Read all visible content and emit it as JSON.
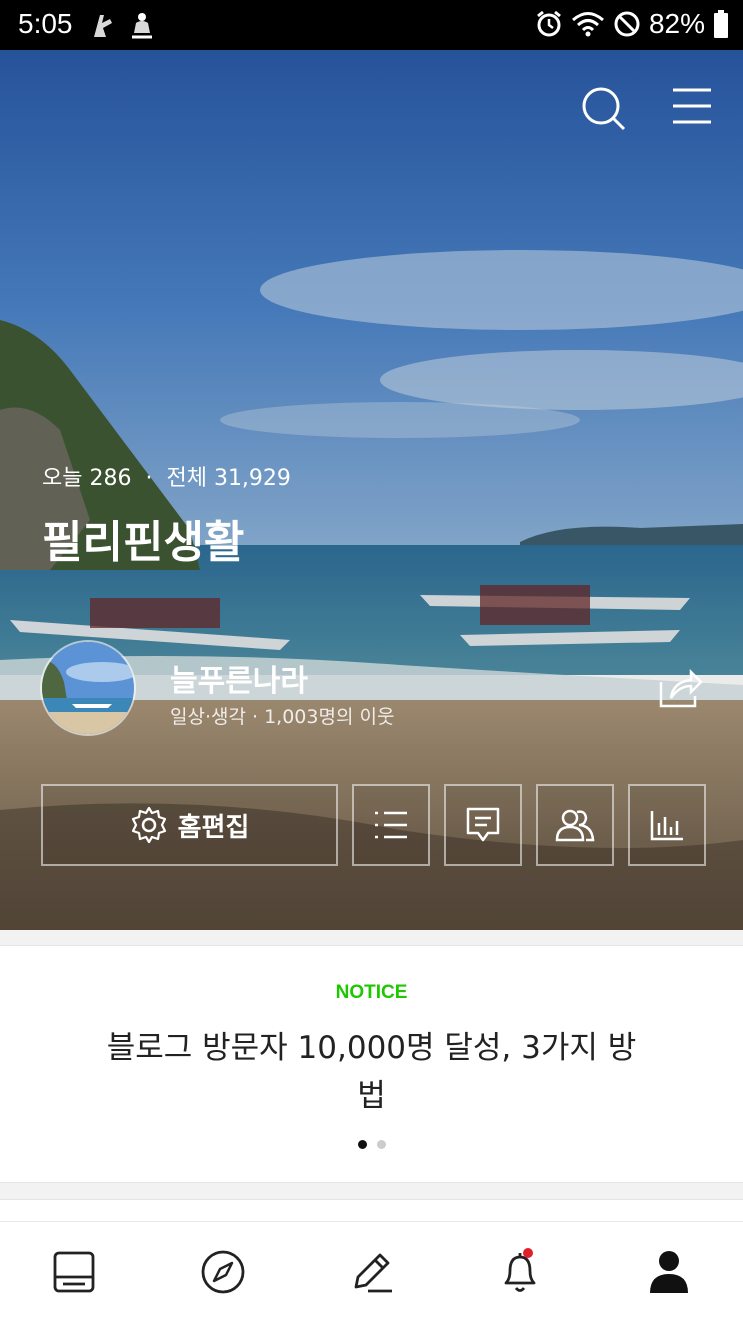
{
  "status_bar": {
    "time": "5:05",
    "battery": "82%",
    "icons": [
      "notification-icon",
      "download-icon",
      "alarm-icon",
      "wifi-icon",
      "do-not-disturb-icon",
      "battery-icon"
    ]
  },
  "hero": {
    "background": "beach-photo",
    "stats": {
      "today_label": "오늘 286",
      "separator": "·",
      "total_label": "전체 31,929"
    },
    "blog_title": "필리핀생활",
    "profile": {
      "nickname": "늘푸른나라",
      "subtitle": "일상·생각 · 1,003명의 이웃"
    },
    "buttons": {
      "edit_home": "홈편집"
    }
  },
  "notice": {
    "label": "NOTICE",
    "title": "블로그 방문자 10,000명 달성, 3가지 방법",
    "page_count": 2,
    "active_page": 1
  },
  "colors": {
    "notice_accent": "#1ec800",
    "badge": "#e0202a",
    "status_bar_bg": "#000000"
  },
  "bottom_nav": {
    "items": [
      "feed-icon",
      "compass-icon",
      "write-icon",
      "bell-icon",
      "profile-icon"
    ],
    "active": "profile-icon",
    "notification_badge": true
  }
}
